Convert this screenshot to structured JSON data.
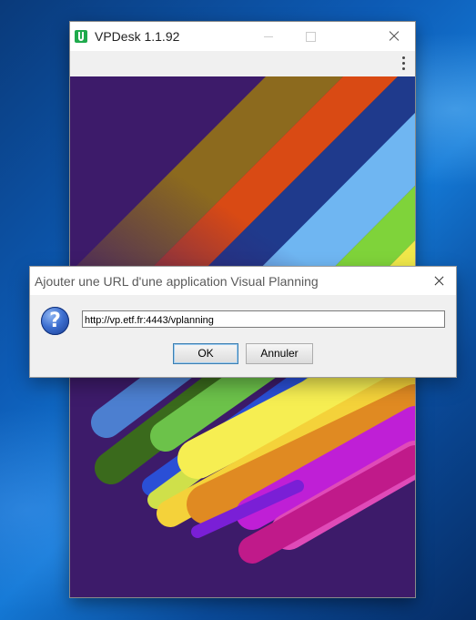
{
  "app_window": {
    "title": "VPDesk 1.1.92",
    "icons": {
      "app": "app-logo-icon",
      "menu": "more-vertical-icon"
    }
  },
  "dialog": {
    "title": "Ajouter une URL d'une application Visual Planning",
    "icon": "question-icon",
    "icon_glyph": "?",
    "url_value": "http://vp.etf.fr:4443/vplanning",
    "ok_label": "OK",
    "cancel_label": "Annuler"
  },
  "colors": {
    "desktop": "#0d5bb5",
    "art_background": "#3d1b6a",
    "stripes": [
      "#8c6a1e",
      "#d94a14",
      "#1f3a8c",
      "#6fb6f2",
      "#7fd33a",
      "#f0e84a"
    ],
    "bottom_stripes": [
      "#4c7fd0",
      "#6cc24a",
      "#f6ee52",
      "#f4d23a",
      "#e08a22",
      "#bf1fd6",
      "#e04ab8",
      "#c01a8a",
      "#3a6a1c"
    ]
  }
}
